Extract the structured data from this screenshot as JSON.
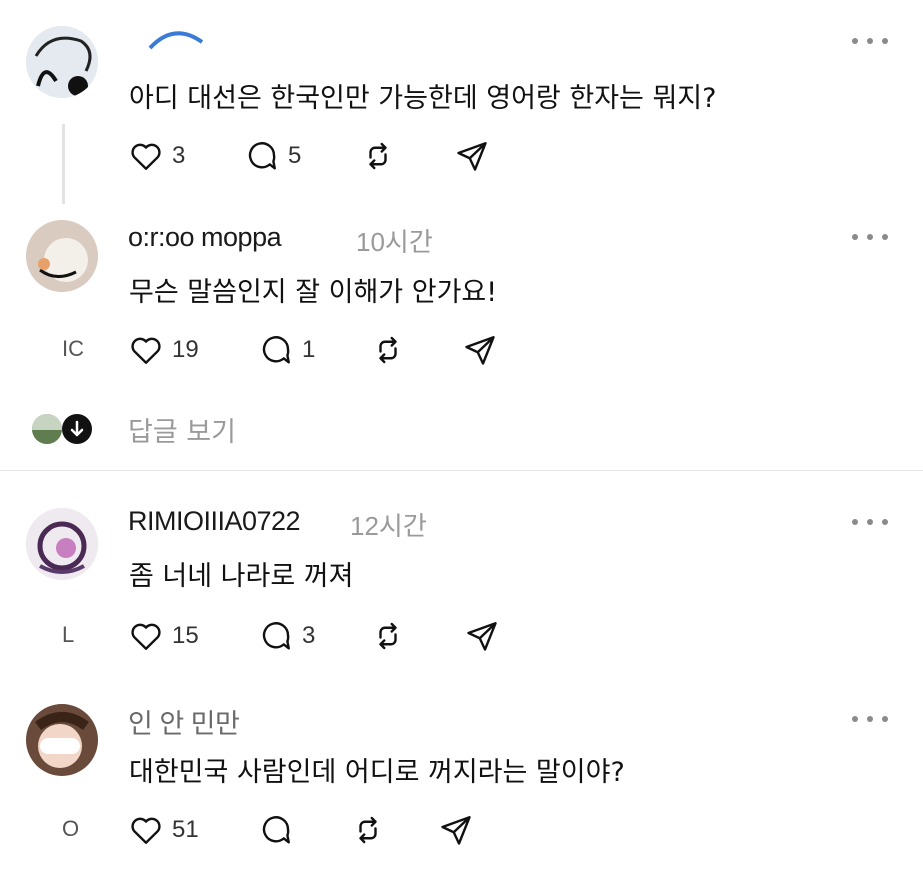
{
  "posts": [
    {
      "username": "",
      "time": "",
      "text": "아디 대선은 한국인만 가능한데 영어랑 한자는 뭐지?",
      "likes": "3",
      "replies": "5",
      "side_mark": ""
    },
    {
      "username": "o:r:oo moppa",
      "time": "10시간",
      "text": "무슨 말씀인지 잘 이해가 안가요!",
      "likes": "19",
      "replies": "1",
      "side_mark": "IC"
    },
    {
      "username": "RIMIOIIIA0722",
      "time": "12시간",
      "text": "좀 너네 나라로 꺼져",
      "likes": "15",
      "replies": "3",
      "side_mark": "L"
    },
    {
      "username": "인  안  민만",
      "time": "",
      "text": "대한민국 사람인데 어디로 꺼지라는 말이야?",
      "likes": "51",
      "replies": "",
      "side_mark": "O"
    }
  ],
  "view_replies": "답글 보기",
  "icons": [
    "heart-icon",
    "comment-icon",
    "repost-icon",
    "share-icon",
    "more-icon",
    "arrow-down-icon"
  ],
  "colors": {
    "text": "#111111",
    "muted": "#9a9a9a",
    "divider": "#e6e6e6"
  }
}
